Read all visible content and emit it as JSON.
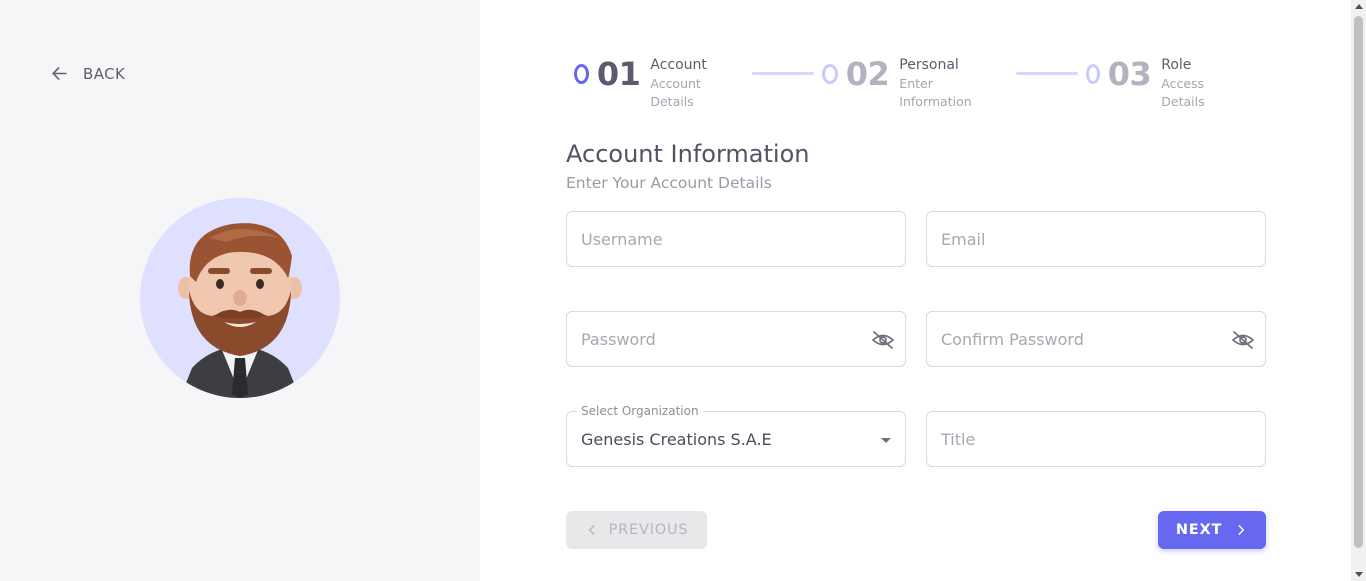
{
  "back": {
    "label": "BACK"
  },
  "stepper": {
    "steps": [
      {
        "number": "01",
        "title": "Account",
        "subtitle": "Account Details",
        "active": true
      },
      {
        "number": "02",
        "title": "Personal",
        "subtitle": "Enter Information",
        "active": false
      },
      {
        "number": "03",
        "title": "Role",
        "subtitle": "Access Details",
        "active": false
      }
    ]
  },
  "form": {
    "title": "Account Information",
    "subtitle": "Enter Your Account Details",
    "username": {
      "placeholder": "Username",
      "value": ""
    },
    "email": {
      "placeholder": "Email",
      "value": ""
    },
    "password": {
      "placeholder": "Password",
      "value": ""
    },
    "confirm_password": {
      "placeholder": "Confirm Password",
      "value": ""
    },
    "organization": {
      "label": "Select Organization",
      "value": "Genesis Creations S.A.E"
    },
    "title_field": {
      "placeholder": "Title",
      "value": ""
    }
  },
  "buttons": {
    "previous": "PREVIOUS",
    "next": "NEXT"
  },
  "colors": {
    "accent": "#6668f0",
    "left_panel_bg": "#f6f6f8",
    "avatar_bg": "#dfe0fd",
    "disabled_btn_bg": "#e8e8ea"
  },
  "icons": {
    "back": "arrow-left-icon",
    "password_visibility": "eye-off-icon",
    "previous": "chevron-left-icon",
    "next": "chevron-right-icon",
    "select": "caret-down-icon"
  }
}
